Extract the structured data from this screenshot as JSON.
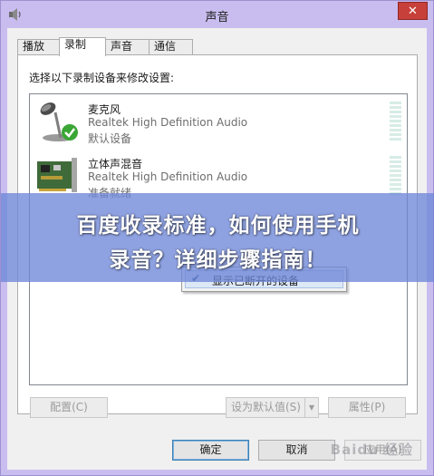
{
  "window": {
    "title": "声音",
    "close_glyph": "✕"
  },
  "tabs": [
    {
      "label": "播放",
      "active": false
    },
    {
      "label": "录制",
      "active": true
    },
    {
      "label": "声音",
      "active": false
    },
    {
      "label": "通信",
      "active": false
    }
  ],
  "panel": {
    "instruction": "选择以下录制设备来修改设置:"
  },
  "devices": [
    {
      "name": "麦克风",
      "description": "Realtek High Definition Audio",
      "status": "默认设备",
      "icon": "microphone-icon",
      "default": true
    },
    {
      "name": "立体声混音",
      "description": "Realtek High Definition Audio",
      "status": "准备就绪",
      "icon": "sound-card-icon",
      "default": false
    }
  ],
  "context_menu": {
    "item_label": "显示已断开的设备",
    "checked": true,
    "check_glyph": "✔"
  },
  "buttons": {
    "configure": "配置(C)",
    "set_default": "设为默认值(S)",
    "properties": "属性(P)",
    "ok": "确定",
    "cancel": "取消",
    "apply": "应用(A)"
  },
  "overlay": {
    "line1": "百度收录标准，如何使用手机",
    "line2": "录音？详细步骤指南！"
  },
  "watermark": "Baidu 经验",
  "colors": {
    "window_frame": "#c9bdf0",
    "close_button": "#c7403a",
    "overlay_band": "#6e87d7",
    "check_badge": "#3aa635"
  }
}
